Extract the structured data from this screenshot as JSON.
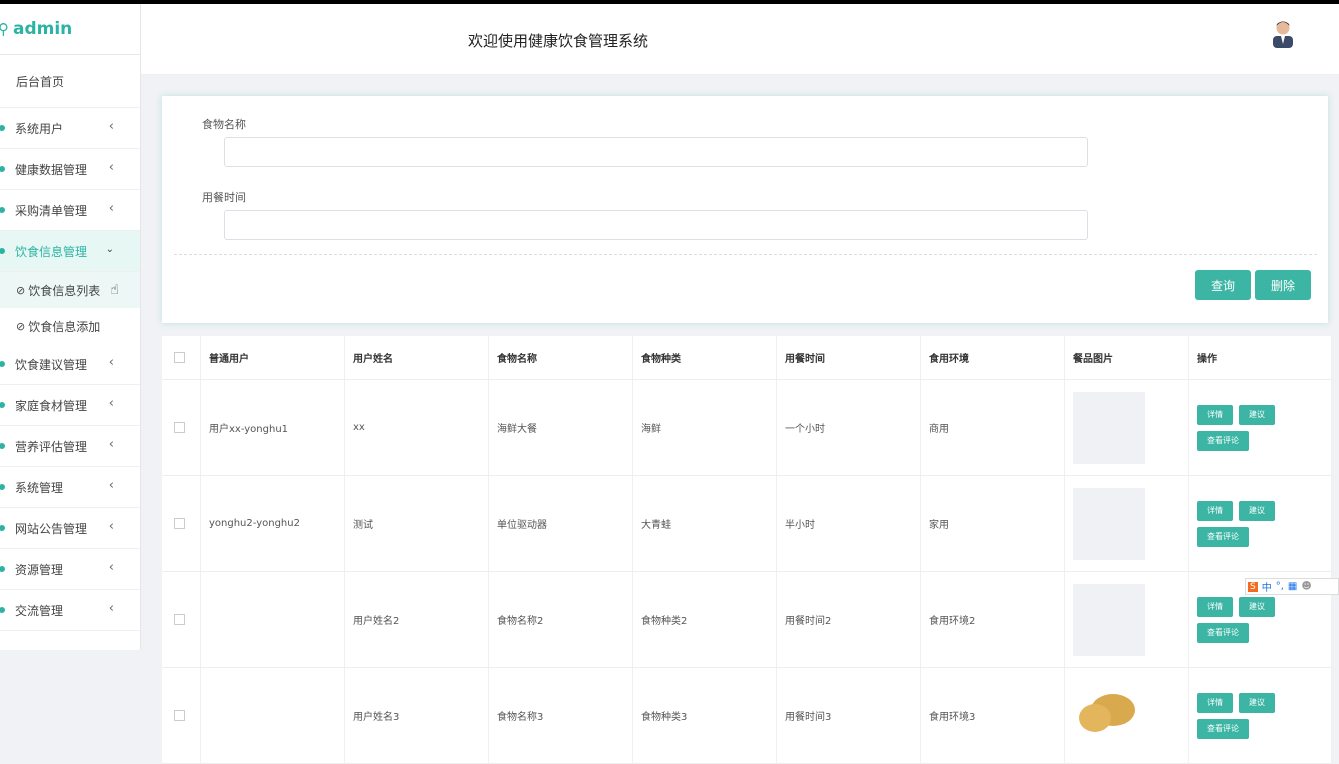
{
  "brand": {
    "name": "admin"
  },
  "header": {
    "title": "欢迎使用健康饮食管理系统"
  },
  "sidebar": {
    "home": "后台首页",
    "items": [
      {
        "label": "系统用户"
      },
      {
        "label": "健康数据管理"
      },
      {
        "label": "采购清单管理"
      },
      {
        "label": "饮食信息管理"
      },
      {
        "label": "饮食建议管理"
      },
      {
        "label": "家庭食材管理"
      },
      {
        "label": "营养评估管理"
      },
      {
        "label": "系统管理"
      },
      {
        "label": "网站公告管理"
      },
      {
        "label": "资源管理"
      },
      {
        "label": "交流管理"
      }
    ],
    "sub": [
      {
        "label": "饮食信息列表"
      },
      {
        "label": "饮食信息添加"
      }
    ]
  },
  "search": {
    "food_name_label": "食物名称",
    "meal_time_label": "用餐时间",
    "query_btn": "查询",
    "delete_btn": "删除"
  },
  "table": {
    "headers": [
      "普通用户",
      "用户姓名",
      "食物名称",
      "食物种类",
      "用餐时间",
      "食用环境",
      "餐品图片",
      "操作"
    ],
    "rows": [
      {
        "user": "用户xx-yonghu1",
        "name": "xx",
        "food": "海鲜大餐",
        "kind": "海鲜",
        "time": "一个小时",
        "env": "商用"
      },
      {
        "user": "yonghu2-yonghu2",
        "name": "测试",
        "food": "单位驱动器",
        "kind": "大青蛙",
        "time": "半小时",
        "env": "家用"
      },
      {
        "user": "",
        "name": "用户姓名2",
        "food": "食物名称2",
        "kind": "食物种类2",
        "time": "用餐时间2",
        "env": "食用环境2"
      },
      {
        "user": "",
        "name": "用户姓名3",
        "food": "食物名称3",
        "kind": "食物种类3",
        "time": "用餐时间3",
        "env": "食用环境3"
      }
    ],
    "op_detail": "详情",
    "op_suggest": "建议",
    "op_comment": "查看评论"
  },
  "ime": {
    "zh": "中"
  },
  "colors": {
    "accent": "#3cb5a4",
    "brand": "#2cb3a4"
  }
}
